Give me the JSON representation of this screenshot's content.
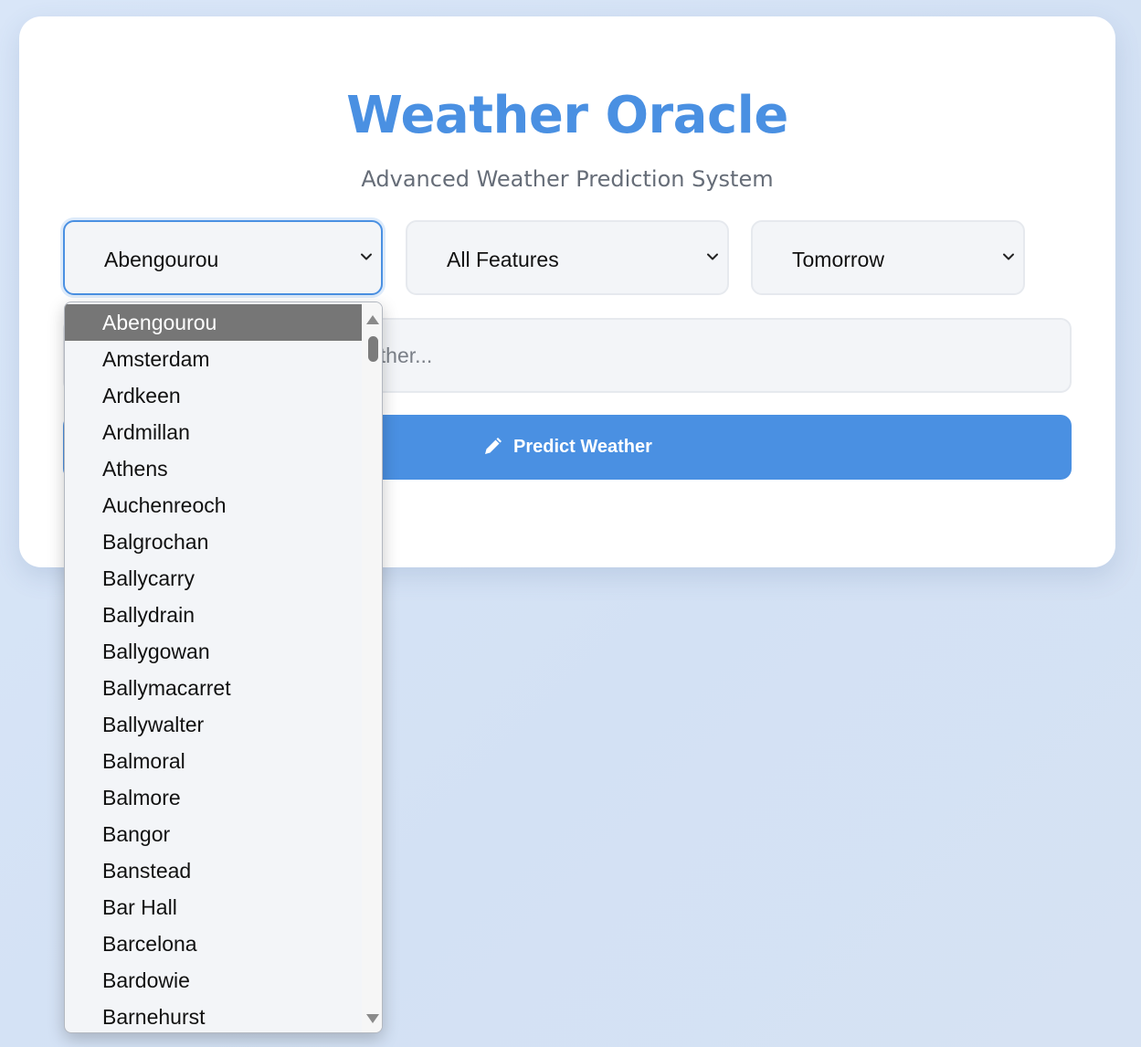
{
  "header": {
    "title": "Weather Oracle",
    "subtitle": "Advanced Weather Prediction System"
  },
  "controls": {
    "location_select": {
      "value": "Abengourou"
    },
    "feature_select": {
      "value": "All Features"
    },
    "time_select": {
      "value": "Tomorrow"
    },
    "question_input": {
      "placeholder": "Ask a question about the weather..."
    },
    "predict_button": {
      "label": "Predict Weather",
      "icon": "pencil-icon"
    }
  },
  "dropdown": {
    "selected_index": 0,
    "options": [
      "Abengourou",
      "Amsterdam",
      "Ardkeen",
      "Ardmillan",
      "Athens",
      "Auchenreoch",
      "Balgrochan",
      "Ballycarry",
      "Ballydrain",
      "Ballygowan",
      "Ballymacarret",
      "Ballywalter",
      "Balmoral",
      "Balmore",
      "Bangor",
      "Banstead",
      "Bar Hall",
      "Barcelona",
      "Bardowie",
      "Barnehurst"
    ]
  },
  "colors": {
    "accent": "#4a90e2",
    "subtitle": "#666d78",
    "field_background": "#f3f5f8",
    "selected_option": "#767676"
  }
}
